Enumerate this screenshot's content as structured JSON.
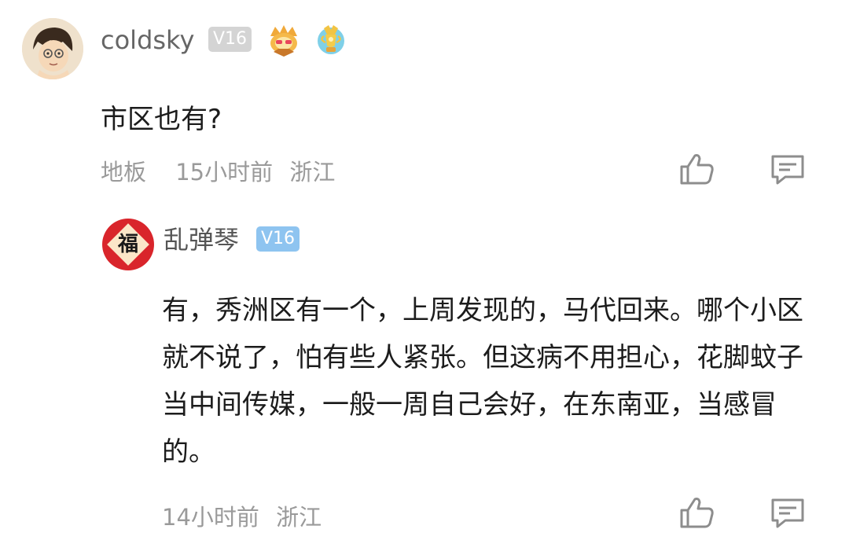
{
  "comment": {
    "username": "coldsky",
    "level": "V16",
    "text": "市区也有?",
    "floor": "地板",
    "time": "15小时前",
    "location": "浙江"
  },
  "reply": {
    "username": "乱弹琴",
    "level": "V16",
    "avatar_glyph": "福",
    "text": "有，秀洲区有一个，上周发现的，马代回来。哪个小区就不说了，怕有些人紧张。但这病不用担心，花脚蚊子当中间传媒，一般一周自己会好，在东南亚，当感冒的。",
    "time": "14小时前",
    "location": "浙江"
  },
  "icons": {
    "like": "thumbs-up-icon",
    "comment": "comment-bubble-icon",
    "badge1": "crown-medal-icon",
    "badge2": "trophy-medal-icon"
  },
  "colors": {
    "meta_text": "#9a9a9a",
    "level_gray": "#d4d4d4",
    "level_blue": "#8ec4f0",
    "fu_red": "#d9252b"
  }
}
